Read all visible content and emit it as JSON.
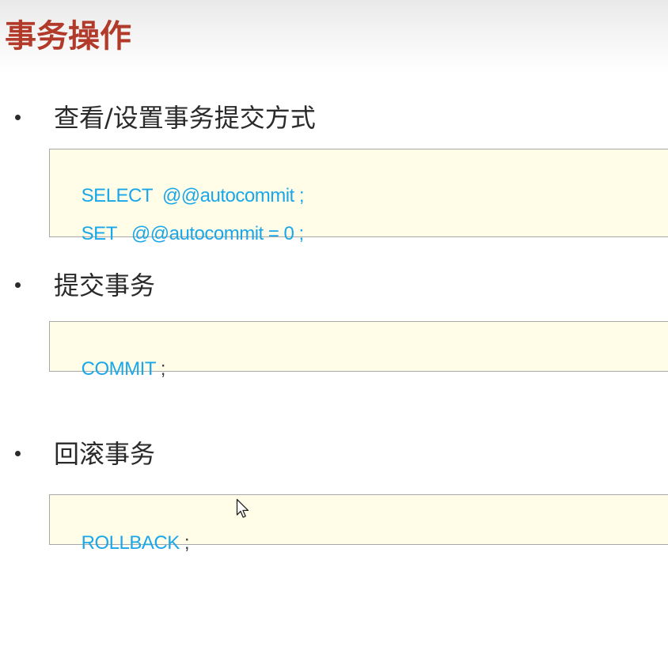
{
  "slide": {
    "title": "事务操作",
    "colors": {
      "title": "#b23a2a",
      "code_keyword": "#1aa7ea",
      "code_box_bg": "#fffde7",
      "code_box_border": "#a9a9a9"
    }
  },
  "sections": [
    {
      "heading": "查看/设置事务提交方式",
      "code_lines": [
        {
          "code": "SELECT  @@autocommit",
          "end": " ;"
        },
        {
          "code": "SET   @@autocommit = 0",
          "end": " ;"
        }
      ]
    },
    {
      "heading": "提交事务",
      "code_lines": [
        {
          "code": "COMMIT",
          "end": " ;"
        }
      ]
    },
    {
      "heading": "回滚事务",
      "code_lines": [
        {
          "code": "ROLLBACK",
          "end": " ;"
        }
      ]
    }
  ],
  "cursor": {
    "icon": "mouse-pointer-icon"
  }
}
